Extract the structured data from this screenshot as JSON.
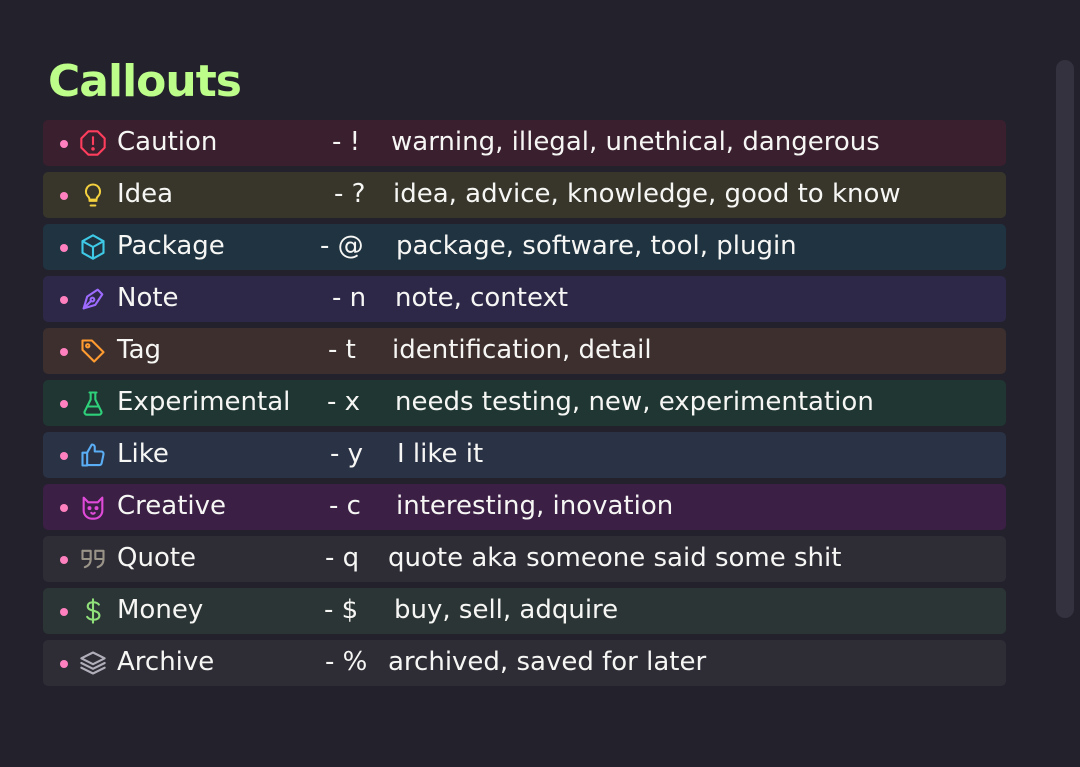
{
  "title": "Callouts",
  "colors": {
    "background": "#22212c",
    "title": "#bdfd8a",
    "bullet": "#ff80bf",
    "text": "#f6f6f4",
    "scrollbar": "#34323f"
  },
  "callouts": [
    {
      "label": "Caution",
      "key": "- !",
      "desc": "warning, illegal, unethical, dangerous",
      "icon": "stop-octagon-icon",
      "icon_color": "#ff3d5c",
      "bg": "#3a1f2e"
    },
    {
      "label": "Idea",
      "key": "- ?",
      "desc": "idea, advice, knowledge, good to know",
      "icon": "lightbulb-icon",
      "icon_color": "#f4d03f",
      "bg": "#38362b"
    },
    {
      "label": "Package",
      "key": "- @",
      "desc": "package, software, tool, plugin",
      "icon": "package-cube-icon",
      "icon_color": "#3ec9e6",
      "bg": "#1f3340"
    },
    {
      "label": "Note",
      "key": "- n",
      "desc": "note, context",
      "icon": "pen-nib-icon",
      "icon_color": "#9d6bff",
      "bg": "#2d2848"
    },
    {
      "label": "Tag",
      "key": "- t",
      "desc": "identification, detail",
      "icon": "tag-icon",
      "icon_color": "#ff9b30",
      "bg": "#3c2f2e"
    },
    {
      "label": "Experimental",
      "key": "- x",
      "desc": "needs testing, new, experimentation",
      "icon": "flask-icon",
      "icon_color": "#2fd07a",
      "bg": "#1f3632"
    },
    {
      "label": "Like",
      "key": "- y",
      "desc": "I like it",
      "icon": "thumbs-up-icon",
      "icon_color": "#5aaef5",
      "bg": "#2a3245"
    },
    {
      "label": "Creative",
      "key": "- c",
      "desc": "interesting, inovation",
      "icon": "cat-face-icon",
      "icon_color": "#e04ad8",
      "bg": "#3b1f45"
    },
    {
      "label": "Quote",
      "key": "- q",
      "desc": "quote aka someone said some shit",
      "icon": "quote-icon",
      "icon_color": "#9a9388",
      "bg": "#2e2d36"
    },
    {
      "label": "Money",
      "key": "- $",
      "desc": "buy, sell, adquire",
      "icon": "dollar-icon",
      "icon_color": "#8fe07a",
      "bg": "#2b3535"
    },
    {
      "label": "Archive",
      "key": "- %",
      "desc": "archived, saved for later",
      "icon": "layers-icon",
      "icon_color": "#b0aeb8",
      "bg": "#2e2d36"
    }
  ]
}
